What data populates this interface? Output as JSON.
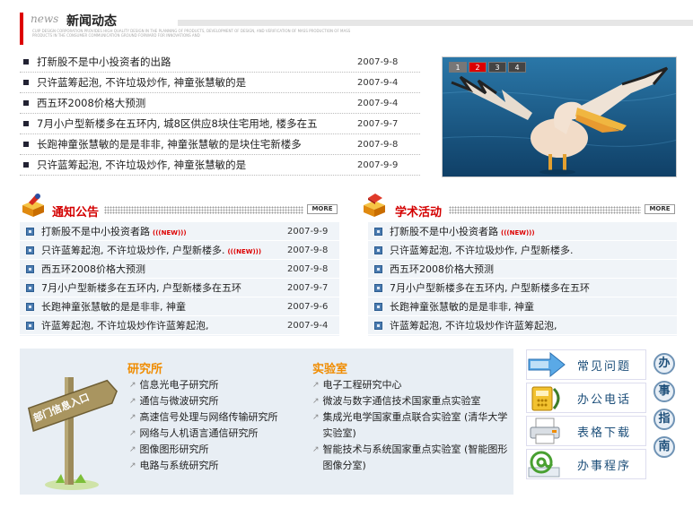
{
  "header": {
    "news_label": "news",
    "title": "新闻动态",
    "description": "CUIP DESIGN CORPORATION PROVIDES HIGH QUALITY DESIGN IN THE PLANNING OF PRODUCTS, DEVELOPMENT OF DESIGN, AND VERIFICATION OF MASS PRODUCTION OF MASS PRODUCTS IN THE CONSUMER COMMUNICATION GROUND FORWARD FOR INNOVATIONS AND"
  },
  "news": [
    {
      "title": "打新股不是中小投资者的出路",
      "date": "2007-9-8"
    },
    {
      "title": "只许蓝筹起泡, 不许垃圾炒作, 神童张慧敏的是",
      "date": "2007-9-4"
    },
    {
      "title": "西五环2008价格大预测",
      "date": "2007-9-4"
    },
    {
      "title": "7月小户型新楼多在五环内, 城8区供应8块住宅用地, 楼多在五",
      "date": "2007-9-7"
    },
    {
      "title": "长跑神童张慧敏的是是非非, 神童张慧敏的是块住宅新楼多",
      "date": "2007-9-8"
    },
    {
      "title": "只许蓝筹起泡, 不许垃圾炒作, 神童张慧敏的是",
      "date": "2007-9-9"
    }
  ],
  "slideshow": {
    "pages": [
      "1",
      "2",
      "3",
      "4"
    ],
    "active": 1
  },
  "notice": {
    "title": "通知公告",
    "more": "MORE",
    "new_tag": "NEW",
    "items": [
      {
        "title": "打新股不是中小投资者路",
        "date": "2007-9-9",
        "is_new": true
      },
      {
        "title": "只许蓝筹起泡, 不许垃圾炒作, 户型新楼多.",
        "date": "2007-9-8",
        "is_new": true
      },
      {
        "title": "西五环2008价格大预测",
        "date": "2007-9-8",
        "is_new": false
      },
      {
        "title": "7月小户型新楼多在五环内, 户型新楼多在五环",
        "date": "2007-9-7",
        "is_new": false
      },
      {
        "title": "长跑神童张慧敏的是是非非, 神童",
        "date": "2007-9-6",
        "is_new": false
      },
      {
        "title": "许蓝筹起泡, 不许垃圾炒作许蓝筹起泡,",
        "date": "2007-9-4",
        "is_new": false
      }
    ]
  },
  "academic": {
    "title": "学术活动",
    "more": "MORE",
    "new_tag": "NEW",
    "items": [
      {
        "title": "打新股不是中小投资者路",
        "is_new": true
      },
      {
        "title": "只许蓝筹起泡, 不许垃圾炒作, 户型新楼多.",
        "is_new": false
      },
      {
        "title": "西五环2008价格大预测",
        "is_new": false
      },
      {
        "title": "7月小户型新楼多在五环内, 户型新楼多在五环",
        "is_new": false
      },
      {
        "title": "长跑神童张慧敏的是是非非, 神童",
        "is_new": false
      },
      {
        "title": "许蓝筹起泡, 不许垃圾炒作许蓝筹起泡,",
        "is_new": false
      }
    ]
  },
  "departments": {
    "sign_text": "部门信息入口",
    "institutes_title": "研究所",
    "institutes": [
      "信息光电子研究所",
      "通信与微波研究所",
      "高速信号处理与网络传输研究所",
      "网络与人机语言通信研究所",
      "图像图形研究所",
      "电路与系统研究所"
    ],
    "labs_title": "实验室",
    "labs": [
      "电子工程研究中心",
      "微波与数字通信技术国家重点实验室",
      "集成光电学国家重点联合实验室 (清华大学实验室)",
      "智能技术与系统国家重点实验室 (智能图形图像分室)"
    ]
  },
  "quick_links": [
    {
      "label": "常见问题",
      "icon": "arrow-faq-icon"
    },
    {
      "label": "办公电话",
      "icon": "phone-icon"
    },
    {
      "label": "表格下载",
      "icon": "printer-icon"
    },
    {
      "label": "办事程序",
      "icon": "at-sign-icon"
    }
  ],
  "guide_chars": [
    "办",
    "事",
    "指",
    "南"
  ],
  "colors": {
    "accent_red": "#d40000",
    "accent_orange": "#f08c00",
    "link_blue": "#1d4f7a"
  }
}
